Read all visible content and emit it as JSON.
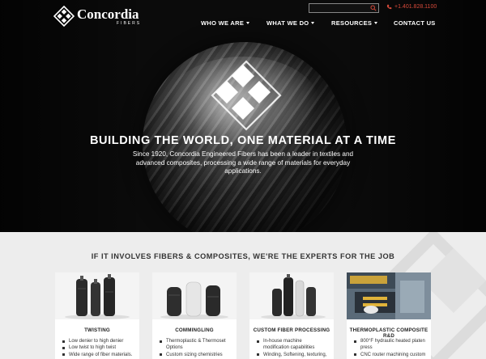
{
  "header": {
    "logo": {
      "name": "Concordia",
      "sub": "FIBERS"
    },
    "search": {
      "placeholder": "",
      "value": ""
    },
    "phone": "+1.401.828.1100",
    "nav": [
      {
        "label": "WHO WE ARE",
        "dropdown": true
      },
      {
        "label": "WHAT WE DO",
        "dropdown": true
      },
      {
        "label": "RESOURCES",
        "dropdown": true
      },
      {
        "label": "CONTACT US",
        "dropdown": false
      }
    ]
  },
  "hero": {
    "headline": "BUILDING THE WORLD, ONE MATERIAL AT A TIME",
    "subtext": "Since 1920, Concordia Engineered Fibers has been a leader in textiles and advanced composites, processing a wide range of materials for everyday applications."
  },
  "section": {
    "title": "IF IT INVOLVES FIBERS & COMPOSITES, WE'RE THE EXPERTS FOR THE JOB",
    "cards": [
      {
        "title": "TWISTING",
        "items": [
          "Low denier to high denier",
          "Low twist to high twist",
          "Wide range of fiber materials."
        ]
      },
      {
        "title": "COMMINGLING",
        "items": [
          "Thermoplastic & Thermoset",
          "Options",
          "Custom sizing chemistries"
        ]
      },
      {
        "title": "CUSTOM FIBER PROCESSING",
        "items": [
          "In-house machine",
          "modification capabilities",
          "Winding, Softening, texturing,"
        ]
      },
      {
        "title": "THERMOPLASTIC COMPOSITE R&D",
        "items": [
          "800°F hydraulic heated platen",
          "press",
          "CNC router machining custom"
        ]
      }
    ]
  },
  "colors": {
    "accent": "#d84a3a",
    "hero_bg": "#0b0b0b",
    "section_bg": "#ededed",
    "text": "#333333"
  }
}
